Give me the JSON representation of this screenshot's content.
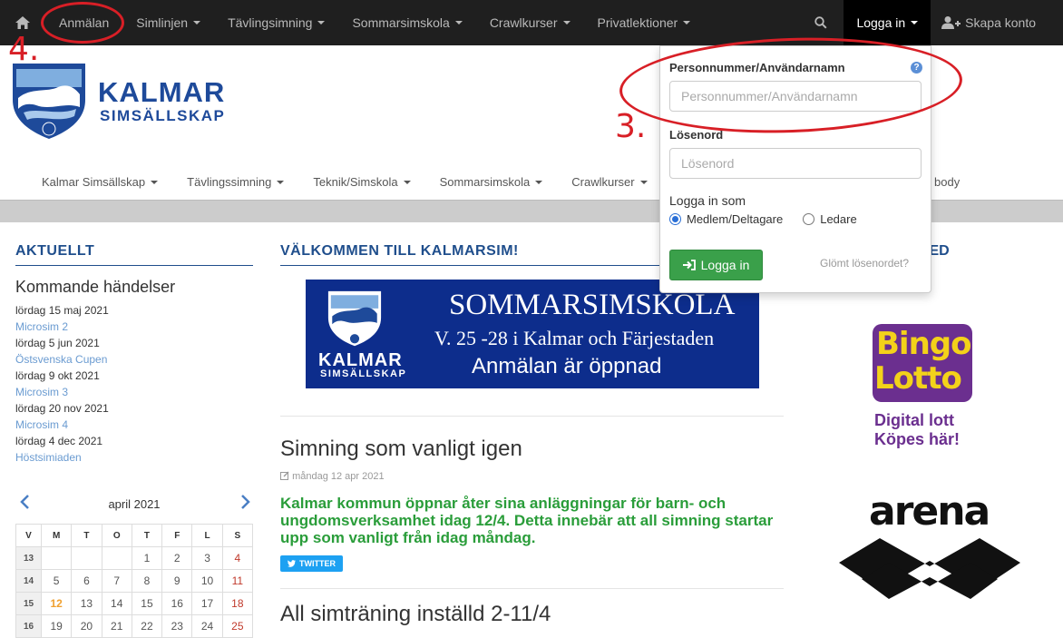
{
  "topnav": {
    "items": [
      {
        "label": "Anmälan",
        "caret": false
      },
      {
        "label": "Simlinjen",
        "caret": true
      },
      {
        "label": "Tävlingsimning",
        "caret": true
      },
      {
        "label": "Sommarsimskola",
        "caret": true
      },
      {
        "label": "Crawlkurser",
        "caret": true
      },
      {
        "label": "Privatlektioner",
        "caret": true
      }
    ],
    "login_label": "Logga in",
    "create_label": "Skapa konto"
  },
  "annotations": {
    "step3": "3.",
    "step4": "4."
  },
  "logo": {
    "name": "KALMAR",
    "sub": "SIMSÄLLSKAP"
  },
  "subnav": {
    "items": [
      "Kalmar Simsällskap",
      "Tävlingssimning",
      "Teknik/Simskola",
      "Sommarsimskola",
      "Crawlkurser"
    ],
    "tail": "body"
  },
  "left": {
    "section_title": "AKTUELLT",
    "events_heading": "Kommande händelser",
    "events": [
      {
        "date": "lördag 15 maj 2021",
        "name": "Microsim 2"
      },
      {
        "date": "lördag 5 jun 2021",
        "name": "Östsvenska Cupen"
      },
      {
        "date": "lördag 9 okt 2021",
        "name": "Microsim 3"
      },
      {
        "date": "lördag 20 nov 2021",
        "name": "Microsim 4"
      },
      {
        "date": "lördag 4 dec 2021",
        "name": "Höstsimiaden"
      }
    ]
  },
  "calendar": {
    "month": "april 2021",
    "headers": [
      "V",
      "M",
      "T",
      "O",
      "T",
      "F",
      "L",
      "S"
    ],
    "rows": [
      [
        "13",
        "",
        "",
        "",
        "1",
        "2",
        "3",
        "4"
      ],
      [
        "14",
        "5",
        "6",
        "7",
        "8",
        "9",
        "10",
        "11"
      ],
      [
        "15",
        "12",
        "13",
        "14",
        "15",
        "16",
        "17",
        "18"
      ],
      [
        "16",
        "19",
        "20",
        "21",
        "22",
        "23",
        "24",
        "25"
      ]
    ]
  },
  "main": {
    "section_title": "VÄLKOMMEN TILL KALMARSIM!",
    "banner": {
      "line1": "SOMMARSIMSKOLA",
      "line2": "V. 25 -28 i Kalmar och Färjestaden",
      "line3": "Anmälan är öppnad",
      "brand": "KALMAR",
      "brand_sub": "SIMSÄLLSKAP"
    },
    "post1": {
      "title": "Simning som vanligt igen",
      "date": "måndag 12 apr 2021",
      "lead": "Kalmar kommun öppnar åter sina anläggningar för barn- och ungdomsverksamhet idag 12/4. Detta innebär att all simning startar upp som vanligt från idag måndag.",
      "share": "TWITTER"
    },
    "post2": {
      "title": "All simträning inställd 2-11/4"
    }
  },
  "right": {
    "section_title_fragment": "IED",
    "bingo": {
      "line1": "Bingo",
      "line2": "Lotto",
      "line3": "Digital lott",
      "line4": "Köpes här!"
    },
    "arena": "arena"
  },
  "login_dropdown": {
    "user_label": "Personnummer/Användarnamn",
    "user_placeholder": "Personnummer/Användarnamn",
    "pass_label": "Lösenord",
    "pass_placeholder": "Lösenord",
    "as_label": "Logga in som",
    "option_member": "Medlem/Deltagare",
    "option_leader": "Ledare",
    "submit": "Logga in",
    "forgot": "Glömt lösenordet?"
  },
  "colors": {
    "brand_blue": "#1e4a9a",
    "green": "#2a9d3a",
    "annotation_red": "#d81f26",
    "nav_dark": "#1f1f1f"
  }
}
